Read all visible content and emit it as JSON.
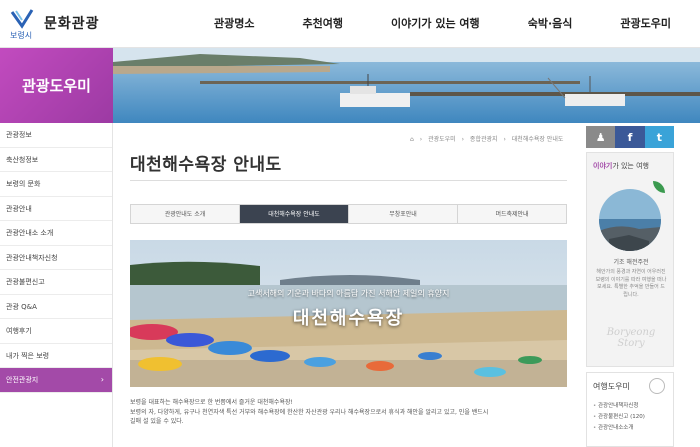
{
  "header": {
    "city_label": "보령시",
    "brand": "문화관광",
    "nav": [
      "관광명소",
      "추천여행",
      "이야기가 있는 여행",
      "숙박·음식",
      "관광도우미"
    ]
  },
  "section_title": "관광도우미",
  "sidebar": {
    "items": [
      {
        "label": "관광정보"
      },
      {
        "label": "축산청정보"
      },
      {
        "label": "보령의 문화"
      },
      {
        "label": "관광안내"
      },
      {
        "label": "관광안내소 소개"
      },
      {
        "label": "관광안내책자신청"
      },
      {
        "label": "관광불편신고"
      },
      {
        "label": "관광 Q&A"
      },
      {
        "label": "여행후기"
      },
      {
        "label": "내가 찍은 보령"
      },
      {
        "label": "안전관광지"
      }
    ],
    "active_index": 10,
    "active_chevron": "›"
  },
  "breadcrumb": [
    "관광도우미",
    "종합관광지",
    "대천해수욕장 안내도"
  ],
  "page_title": "대천해수욕장 안내도",
  "tabs": [
    {
      "label": "관광안내도 소개"
    },
    {
      "label": "대천해수욕장 안내도"
    },
    {
      "label": "무창포안내"
    },
    {
      "label": "머드축제안내"
    }
  ],
  "active_tab": 1,
  "photo": {
    "caption": "고색서해의 기운과 바다의 아름답 가진 서해안 제일의 휴양지",
    "title": "대천해수욕장"
  },
  "body_text": {
    "line1": "보령을 대표하는 해수욕장으로 한 번쯤에서 즐거운 대천해수욕장!",
    "line2": "보령의 자, 다양하게, 유구나 천연자색 특선 거부와 해수욕장에 한산한 자산관광 우리나 해수욕장으로서 휴식과 해안을 알리고 있고, 인을 밴드시",
    "line3": "길매 설 있을 수 있다."
  },
  "social": {
    "person": "♟",
    "facebook": "f",
    "twitter": "t"
  },
  "story": {
    "head_bold": "이야기",
    "head_rest": "가 있는 여행",
    "caption": "기조 해전주전",
    "desc": "해안가의 풍경과 자연이 어우러진 보령의 이야기를 따라 여행을 떠나보세요. 특별한 추억을 만들어 드립니다.",
    "script": "Boryeong Story"
  },
  "guide": {
    "head": "여행도우미",
    "items": [
      "관광안내책자신청",
      "관광불편신고 (120)",
      "관광안내소소개"
    ]
  },
  "colors": {
    "accent": "#a34aa8",
    "tab_active": "#3b4350",
    "facebook": "#3b5998",
    "twitter": "#3aa3d8"
  }
}
